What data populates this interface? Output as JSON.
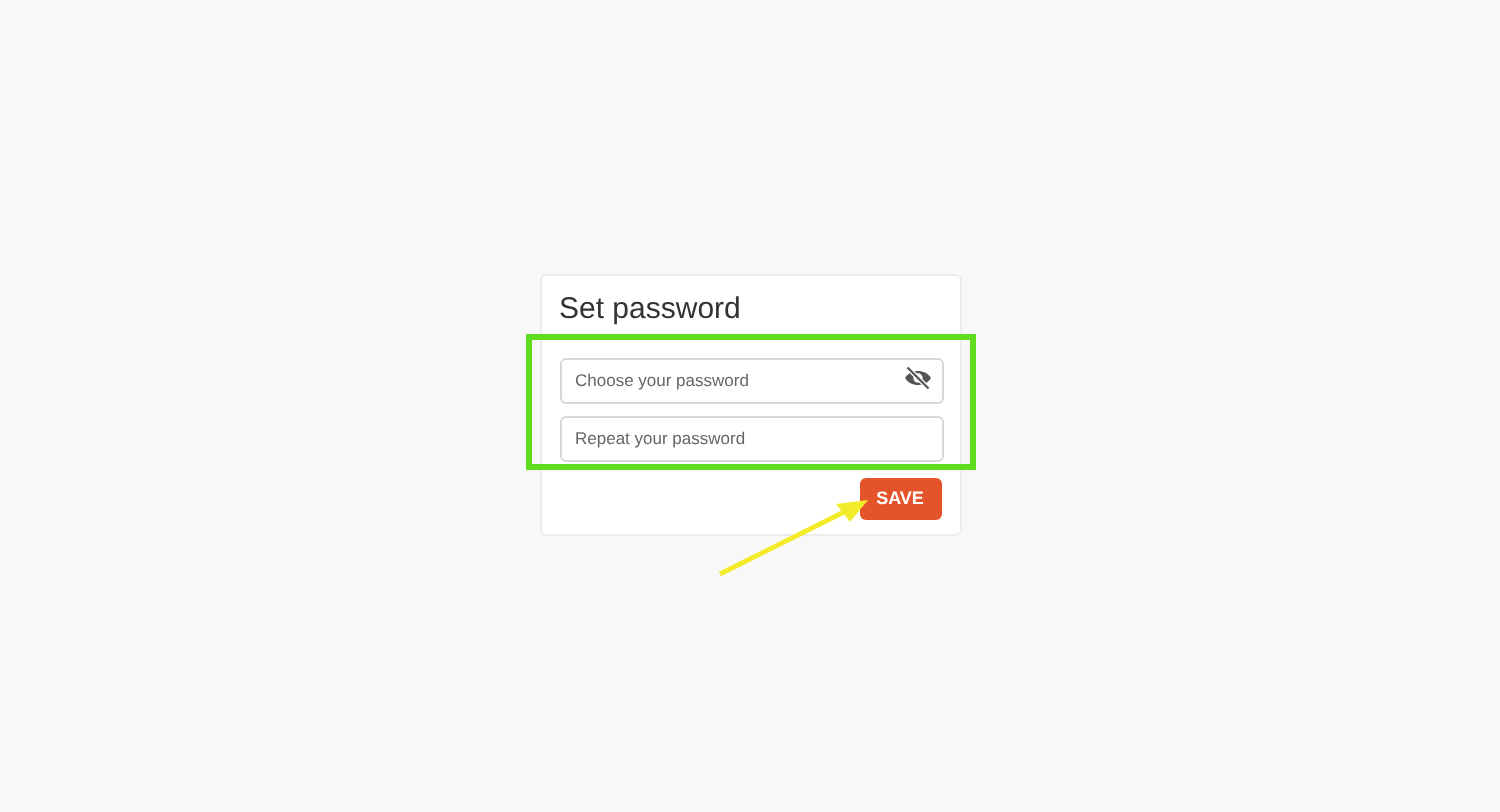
{
  "card": {
    "title": "Set password"
  },
  "fields": [
    {
      "placeholder": "Choose your password",
      "kind": "password-toggle"
    },
    {
      "placeholder": "Repeat your password",
      "kind": "plain"
    }
  ],
  "save_button": {
    "label": "SAVE"
  }
}
